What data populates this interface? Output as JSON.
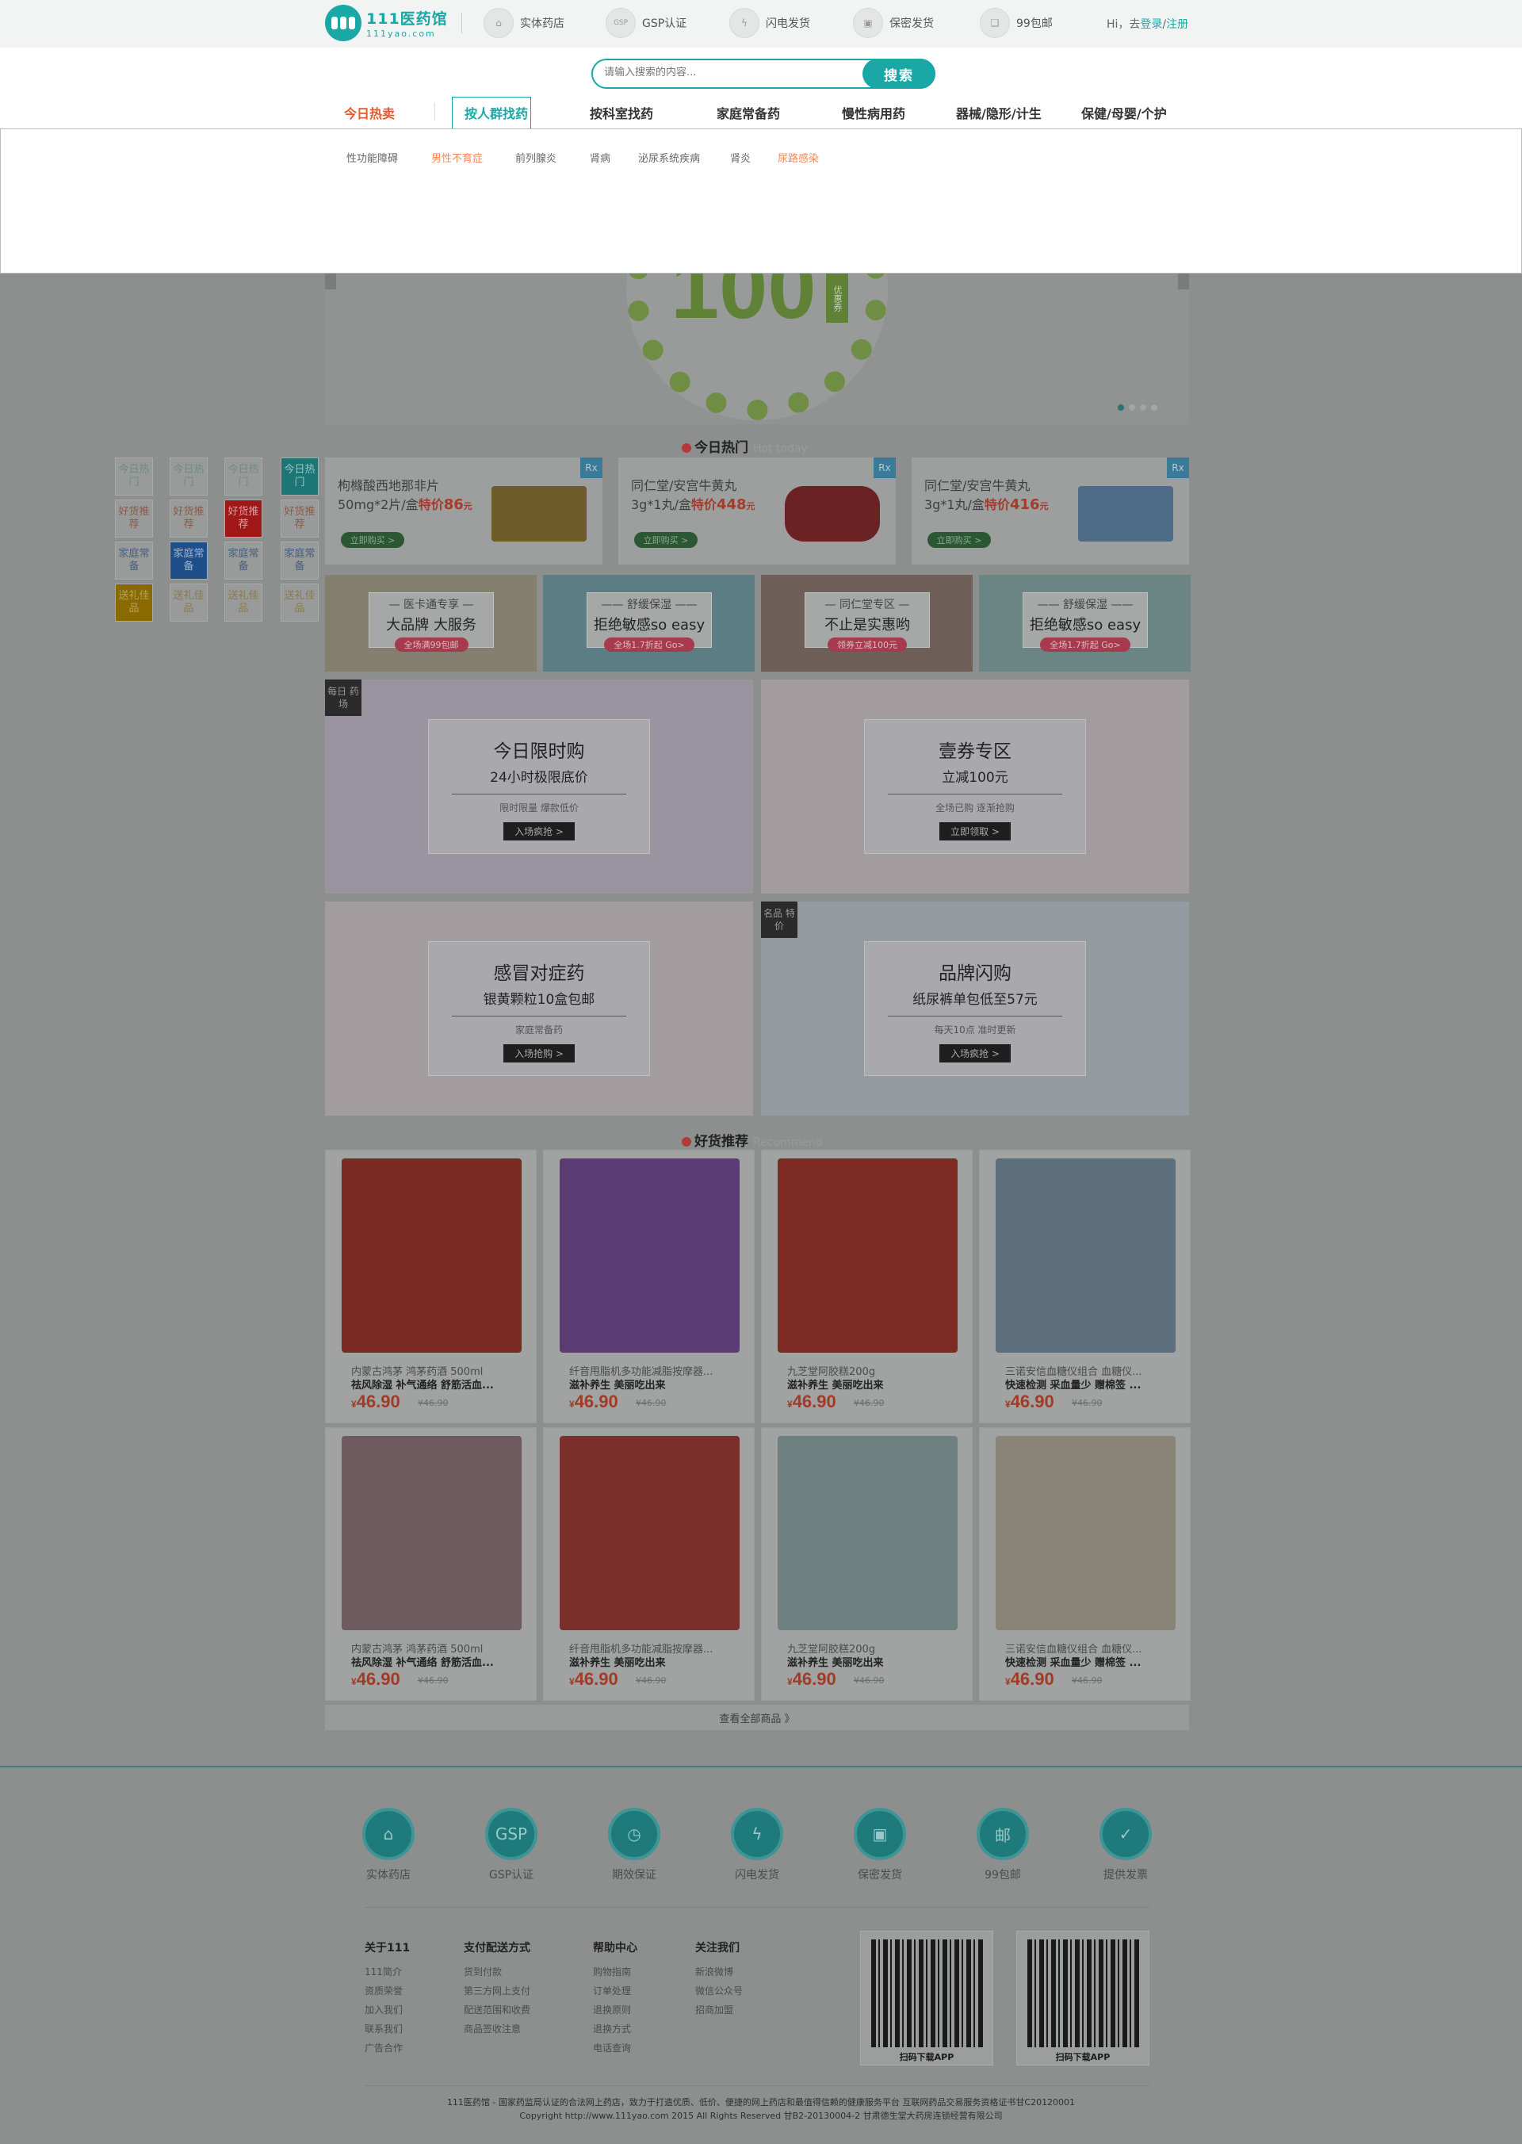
{
  "topbar": {
    "logo_title": "111医药馆",
    "logo_sub": "111yao.com",
    "services": [
      {
        "label": "实体药店",
        "icon": "store-icon"
      },
      {
        "label": "GSP认证",
        "icon": "gsp-icon"
      },
      {
        "label": "闪电发货",
        "icon": "lightning-icon"
      },
      {
        "label": "保密发货",
        "icon": "lock-icon"
      },
      {
        "label": "99包邮",
        "icon": "gift-icon"
      }
    ],
    "greeting": "Hi，去",
    "login": "登录",
    "slash": "/",
    "register": "注册"
  },
  "search": {
    "placeholder": "请输入搜索的内容...",
    "button": "搜索"
  },
  "nav": {
    "items": [
      "今日热卖",
      "按人群找药",
      "按科室找药",
      "家庭常备药",
      "慢性病用药",
      "器械/隐形/计生",
      "保健/母婴/个护"
    ],
    "active_index": 1,
    "hot_color": "#e8572a",
    "accent": "#1aa8a6"
  },
  "dropdown": {
    "items": [
      {
        "label": "性功能障碍",
        "hl": false
      },
      {
        "label": "男性不育症",
        "hl": true
      },
      {
        "label": "前列腺炎",
        "hl": false
      },
      {
        "label": "肾病",
        "hl": false
      },
      {
        "label": "泌尿系统疾病",
        "hl": false
      },
      {
        "label": "肾炎",
        "hl": false
      },
      {
        "label": "尿路感染",
        "hl": true
      }
    ],
    "hl_color": "#f08a5d"
  },
  "banner": {
    "big_number": "100",
    "coupon": "优惠券"
  },
  "today_hot": {
    "title": "今日热门",
    "subtitle": "Hot today",
    "side_tabs": [
      [
        "今日热门",
        "好货推荐",
        "家庭常备",
        "送礼佳品"
      ],
      [
        "今日热门",
        "好货推荐",
        "家庭常备",
        "送礼佳品"
      ],
      [
        "今日热门",
        "好货推荐",
        "家庭常备",
        "送礼佳品"
      ],
      [
        "今日热门",
        "好货推荐",
        "家庭常备",
        "送礼佳品"
      ]
    ],
    "cards": [
      {
        "name": "枸橼酸西地那非片",
        "spec": "50mg*2片/盒",
        "price_label": "特价",
        "price": "86",
        "unit": "元",
        "button": "立即购买 >",
        "rx": "Rx"
      },
      {
        "name": "同仁堂/安宫牛黄丸",
        "spec": "3g*1丸/盒",
        "price_label": "特价",
        "price": "448",
        "unit": "元",
        "button": "立即购买 >",
        "rx": "Rx"
      },
      {
        "name": "同仁堂/安宫牛黄丸",
        "spec": "3g*1丸/盒",
        "price_label": "特价",
        "price": "416",
        "unit": "元",
        "button": "立即购买 >",
        "rx": "Rx"
      }
    ],
    "promos": [
      {
        "l1": "— 医卡通专享 —",
        "l2": "大品牌 大服务",
        "l3": "全场满99包邮"
      },
      {
        "l1": "—— 舒缓保湿 ——",
        "l2": "拒绝敏感so easy",
        "l3": "全场1.7折起 Go>"
      },
      {
        "l1": "— 同仁堂专区 —",
        "l2": "不止是实惠哟",
        "l3": "领券立减100元"
      },
      {
        "l1": "—— 舒缓保湿 ——",
        "l2": "拒绝敏感so easy",
        "l3": "全场1.7折起 Go>"
      }
    ],
    "big": [
      {
        "corner": "每日 药场",
        "l1": "今日限时购",
        "l2": "24小时极限底价",
        "l3": "限时限量 爆款低价",
        "btn": "入场疯抢 >"
      },
      {
        "corner": "",
        "l1": "壹券专区",
        "l2": "立减100元",
        "l3": "全场已购 逐渐抢购",
        "btn": "立即领取 >"
      },
      {
        "corner": "",
        "l1": "感冒对症药",
        "l2": "银黄颗粒10盒包邮",
        "l3": "家庭常备药",
        "btn": "入场抢购 >"
      },
      {
        "corner": "名品 特价",
        "l1": "品牌闪购",
        "l2": "纸尿裤单包低至57元",
        "l3": "每天10点 准时更新",
        "btn": "入场疯抢 >"
      }
    ]
  },
  "recommend": {
    "title": "好货推荐",
    "subtitle": "Recommend",
    "currency": "¥",
    "products": [
      {
        "n1": "内蒙古鸿茅 鸿茅药酒 500ml",
        "n2": "祛风除湿 补气通络 舒筋活血...",
        "price": "46.90",
        "old": "¥46.90",
        "color": "#7a2a22"
      },
      {
        "n1": "纤音甩脂机多功能减脂按摩器...",
        "n2": "滋补养生 美丽吃出来",
        "price": "46.90",
        "old": "¥46.90",
        "color": "#5a3c72"
      },
      {
        "n1": "九芝堂阿胶糕200g",
        "n2": "滋补养生 美丽吃出来",
        "price": "46.90",
        "old": "¥46.90",
        "color": "#7e2a24"
      },
      {
        "n1": "三诺安信血糖仪组合 血糖仪...",
        "n2": "快速检测 采血量少 赠棉签 ...",
        "price": "46.90",
        "old": "¥46.90",
        "color": "#5d6e7c"
      },
      {
        "n1": "内蒙古鸿茅 鸿茅药酒 500ml",
        "n2": "祛风除湿 补气通络 舒筋活血...",
        "price": "46.90",
        "old": "¥46.90",
        "color": "#6e5a5f"
      },
      {
        "n1": "纤音甩脂机多功能减脂按摩器...",
        "n2": "滋补养生 美丽吃出来",
        "price": "46.90",
        "old": "¥46.90",
        "color": "#7b2f2a"
      },
      {
        "n1": "九芝堂阿胶糕200g",
        "n2": "滋补养生 美丽吃出来",
        "price": "46.90",
        "old": "¥46.90",
        "color": "#6e8080"
      },
      {
        "n1": "三诺安信血糖仪组合 血糖仪...",
        "n2": "快速检测 采血量少 赠棉签 ...",
        "price": "46.90",
        "old": "¥46.90",
        "color": "#8a8478"
      }
    ],
    "see_all": "查看全部商品 》"
  },
  "footer": {
    "services": [
      {
        "label": "实体药店",
        "icon": "store-icon",
        "glyph": "⌂"
      },
      {
        "label": "GSP认证",
        "icon": "gsp-icon",
        "glyph": "GSP"
      },
      {
        "label": "期效保证",
        "icon": "clock-icon",
        "glyph": "◷"
      },
      {
        "label": "闪电发货",
        "icon": "lightning-icon",
        "glyph": "ϟ"
      },
      {
        "label": "保密发货",
        "icon": "lock-icon",
        "glyph": "▣"
      },
      {
        "label": "99包邮",
        "icon": "mail-icon",
        "glyph": "邮"
      },
      {
        "label": "提供发票",
        "icon": "invoice-icon",
        "glyph": "✓"
      }
    ],
    "columns": [
      {
        "title": "关于111",
        "links": [
          "111简介",
          "资质荣誉",
          "加入我们",
          "联系我们",
          "广告合作"
        ]
      },
      {
        "title": "支付配送方式",
        "links": [
          "货到付款",
          "第三方网上支付",
          "配送范围和收费",
          "商品签收注意"
        ]
      },
      {
        "title": "帮助中心",
        "links": [
          "购物指南",
          "订单处理",
          "退换原则",
          "退换方式",
          "电话查询"
        ]
      },
      {
        "title": "关注我们",
        "links": [
          "新浪微博",
          "微信公众号",
          "招商加盟"
        ]
      }
    ],
    "qr": [
      "扫码下载APP",
      "扫码下载APP"
    ],
    "copy1": "111医药馆 - 国家药监局认证的合法网上药店，致力于打造优质、低价、便捷的网上药店和最值得信赖的健康服务平台 互联网药品交易服务资格证书甘C20120001",
    "copy2": "Copyright http://www.111yao.com 2015 All Rights Reserved 甘B2-20130004-2 甘肃德生堂大药房连锁经营有限公司"
  }
}
